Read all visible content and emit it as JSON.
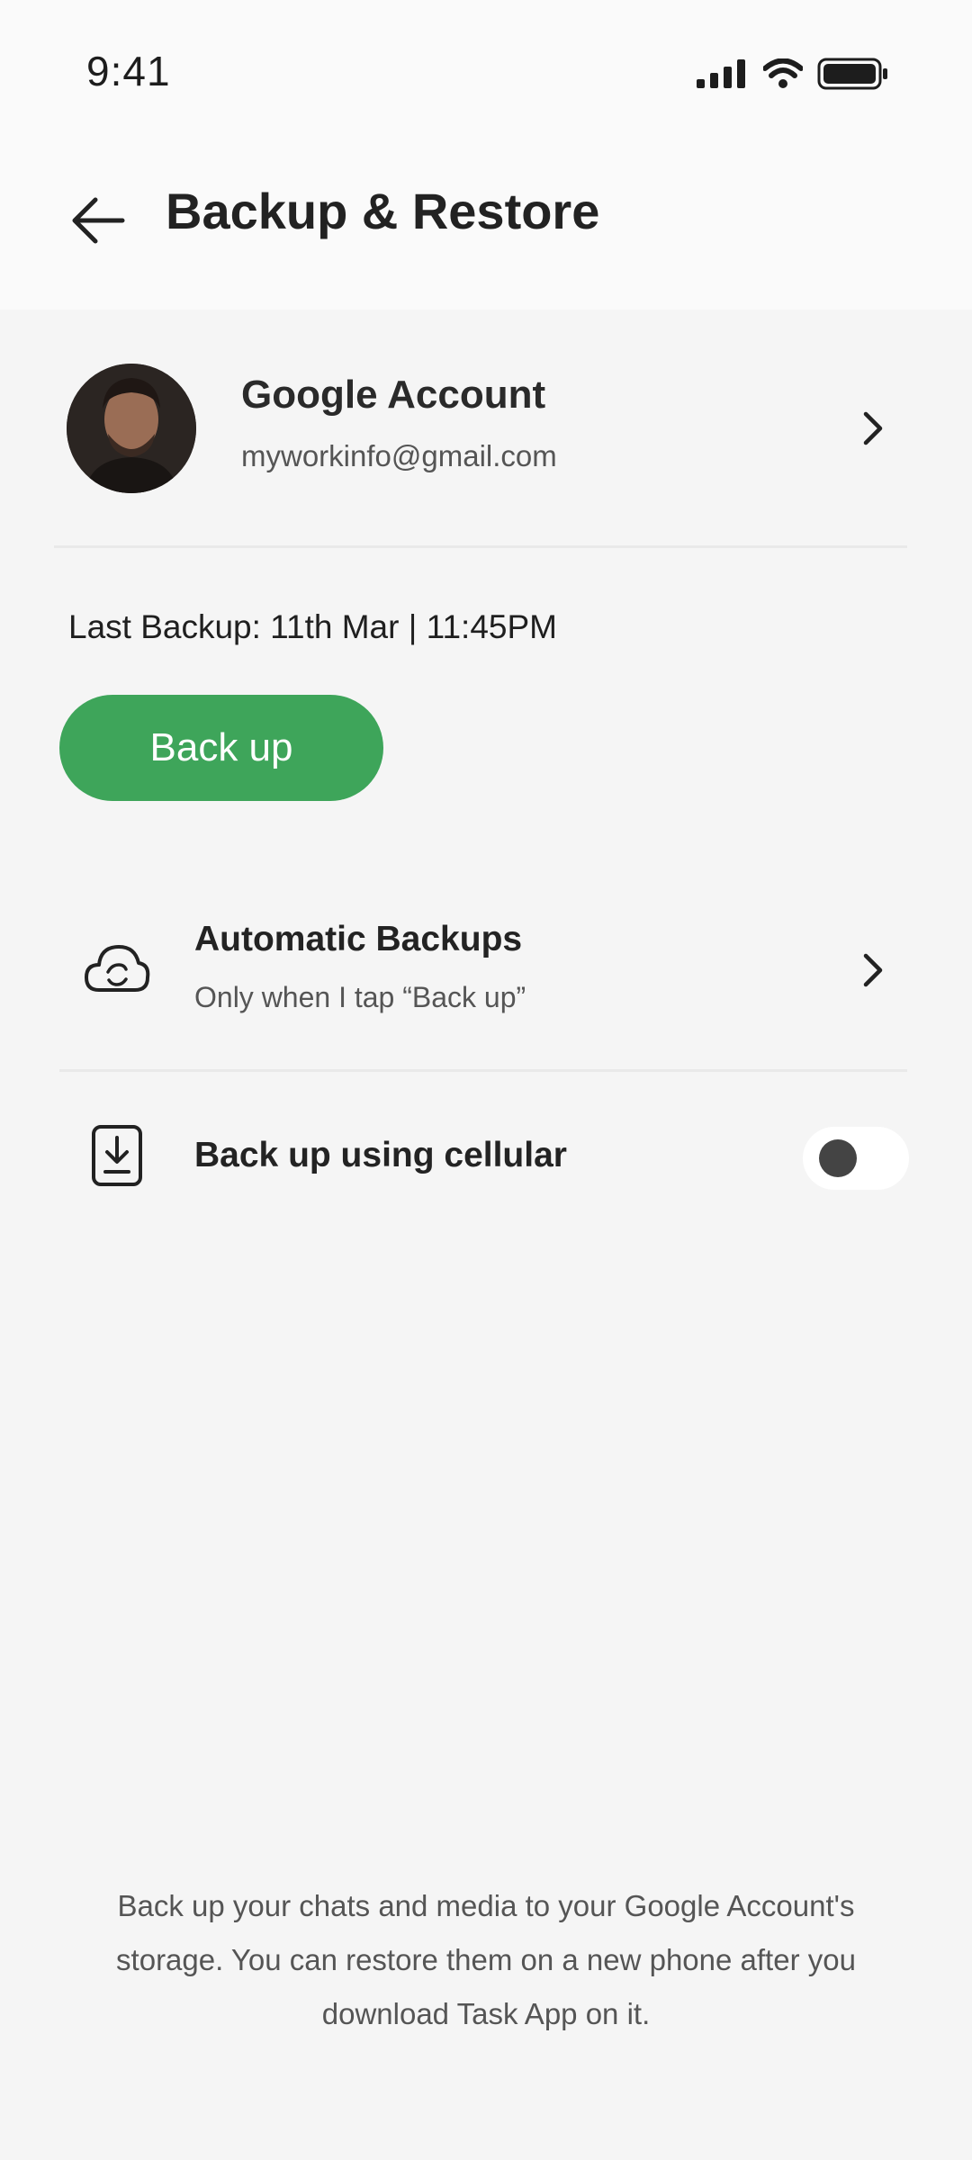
{
  "status_bar": {
    "time": "9:41"
  },
  "header": {
    "title": "Backup & Restore"
  },
  "account": {
    "title": "Google Account",
    "email": "myworkinfo@gmail.com"
  },
  "last_backup": "Last Backup: 11th Mar | 11:45PM",
  "backup_button": "Back up",
  "settings": {
    "automatic": {
      "title": "Automatic Backups",
      "subtitle": "Only when I tap “Back up”"
    },
    "cellular": {
      "title": "Back up using cellular",
      "enabled": false
    }
  },
  "footer_note": "Back up your chats and media to your Google Account's storage. You can restore them on a new phone after you download Task App on it.",
  "colors": {
    "accent": "#3ea55a",
    "background": "#f5f5f5",
    "header": "#fafafa"
  },
  "icons": [
    "signal-icon",
    "wifi-icon",
    "battery-icon",
    "back-arrow-icon",
    "chevron-right-icon",
    "cloud-sync-icon",
    "download-icon"
  ]
}
